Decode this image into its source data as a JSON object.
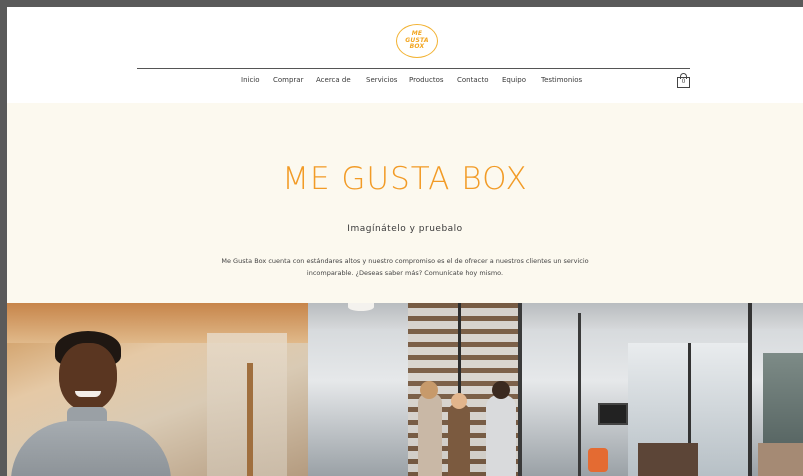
{
  "brand": {
    "logo_lines": [
      "ME",
      "GUSTA",
      "BOX"
    ],
    "accent_color": "#f29b26"
  },
  "nav": {
    "items": [
      {
        "label": "Inicio"
      },
      {
        "label": "Comprar"
      },
      {
        "label": "Acerca de"
      },
      {
        "label": "Servicios"
      },
      {
        "label": "Productos"
      },
      {
        "label": "Contacto"
      },
      {
        "label": "Equipo"
      },
      {
        "label": "Testimonios"
      }
    ],
    "cart_icon": "shopping-bag-icon",
    "cart_count": "0"
  },
  "hero": {
    "title": "ME GUSTA BOX",
    "subtitle": "Imagínátelo y pruebalo",
    "body_line1": "Me Gusta Box cuenta con estándares altos y nuestro compromiso es el de ofrecer a nuestros clientes un servicio",
    "body_line2": "incomparable. ¿Deseas saber más? Comunícate hoy mismo.",
    "background_color": "#fcf9ef"
  },
  "photos": {
    "left_image": "smiling-woman-photo",
    "right_image": "office-team-photo"
  }
}
